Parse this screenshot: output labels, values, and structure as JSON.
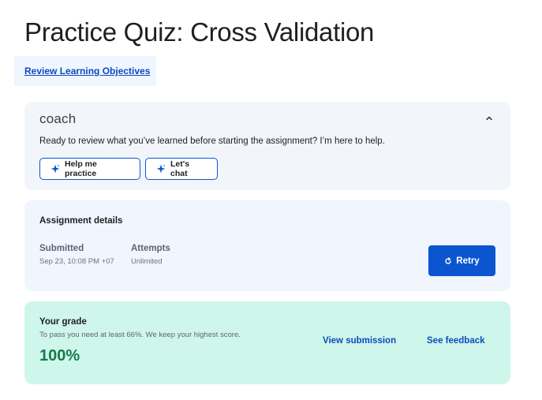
{
  "page": {
    "title": "Practice Quiz: Cross Validation",
    "review_link": "Review Learning Objectives"
  },
  "coach": {
    "logo": "coach",
    "message": "Ready to review what you’ve learned before starting the assignment? I’m here to help.",
    "buttons": [
      {
        "label": "Help me practice",
        "icon": "sparkle-icon"
      },
      {
        "label": "Let's chat",
        "icon": "sparkle-icon"
      }
    ],
    "collapse_icon": "chevron-up-icon"
  },
  "assignment": {
    "title": "Assignment details",
    "submitted_label": "Submitted",
    "submitted_value": "Sep 23, 10:08 PM +07",
    "attempts_label": "Attempts",
    "attempts_value": "Unlimited",
    "retry_label": "Retry",
    "retry_icon": "refresh-icon"
  },
  "grade": {
    "title": "Your grade",
    "subtitle": "To pass you need at least 66%. We keep your highest score.",
    "value": "100%",
    "view_submission": "View submission",
    "see_feedback": "See feedback"
  },
  "colors": {
    "accent": "#0b56d0",
    "link": "#0b4bbf",
    "grade_bg": "#cff6ea",
    "grade_text": "#157a4c",
    "card_bg": "#f2f5fa"
  }
}
